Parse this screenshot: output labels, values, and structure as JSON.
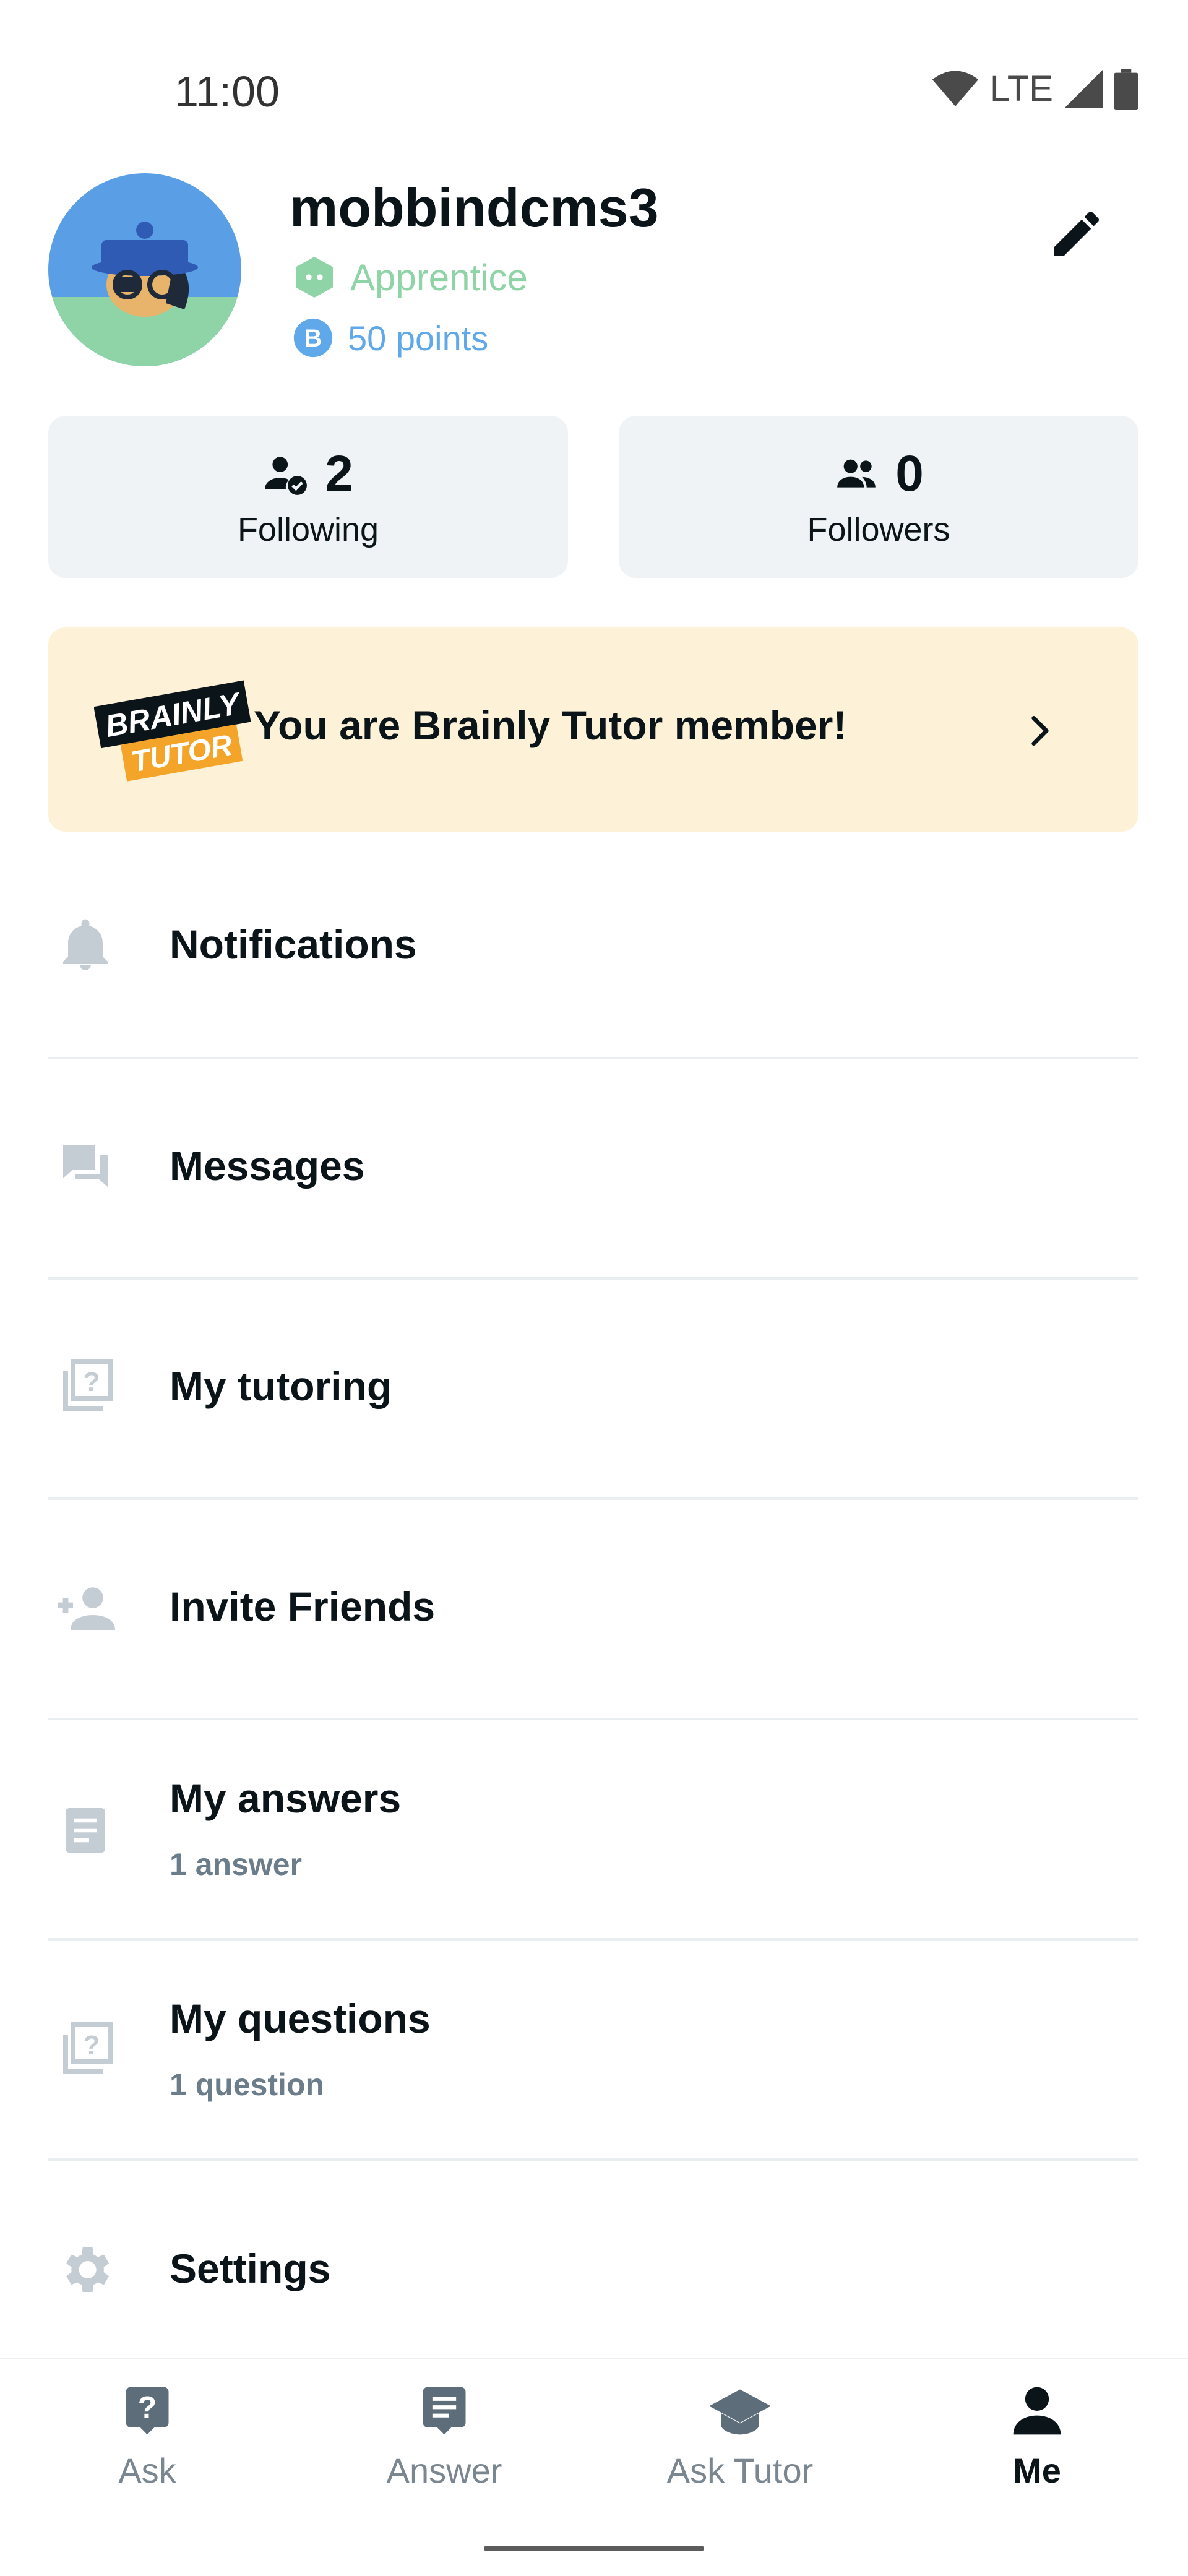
{
  "status_bar": {
    "time": "11:00",
    "network": "LTE"
  },
  "profile": {
    "username": "mobbindcms3",
    "rank": "Apprentice",
    "points": "50 points",
    "rank_color": "#8fd4a6",
    "points_color": "#5fa8ea"
  },
  "stats": {
    "following": {
      "count": "2",
      "label": "Following"
    },
    "followers": {
      "count": "0",
      "label": "Followers"
    }
  },
  "tutor_banner": {
    "logo_text_1": "BRAINLY",
    "logo_text_2": "TUTOR",
    "message": "You are Brainly Tutor member!",
    "background": "#fdf2d8"
  },
  "menu": [
    {
      "title": "Notifications",
      "icon": "bell-icon"
    },
    {
      "title": "Messages",
      "icon": "messages-icon"
    },
    {
      "title": "My tutoring",
      "icon": "tutoring-icon"
    },
    {
      "title": "Invite Friends",
      "icon": "add-person-icon"
    },
    {
      "title": "My answers",
      "subtitle": "1 answer",
      "icon": "answers-icon"
    },
    {
      "title": "My questions",
      "subtitle": "1 question",
      "icon": "questions-icon"
    },
    {
      "title": "Settings",
      "icon": "gear-icon"
    }
  ],
  "bottom_nav": [
    {
      "label": "Ask",
      "icon": "ask-icon"
    },
    {
      "label": "Answer",
      "icon": "answer-icon"
    },
    {
      "label": "Ask Tutor",
      "icon": "graduation-cap-icon"
    },
    {
      "label": "Me",
      "icon": "person-icon",
      "active": true
    }
  ]
}
